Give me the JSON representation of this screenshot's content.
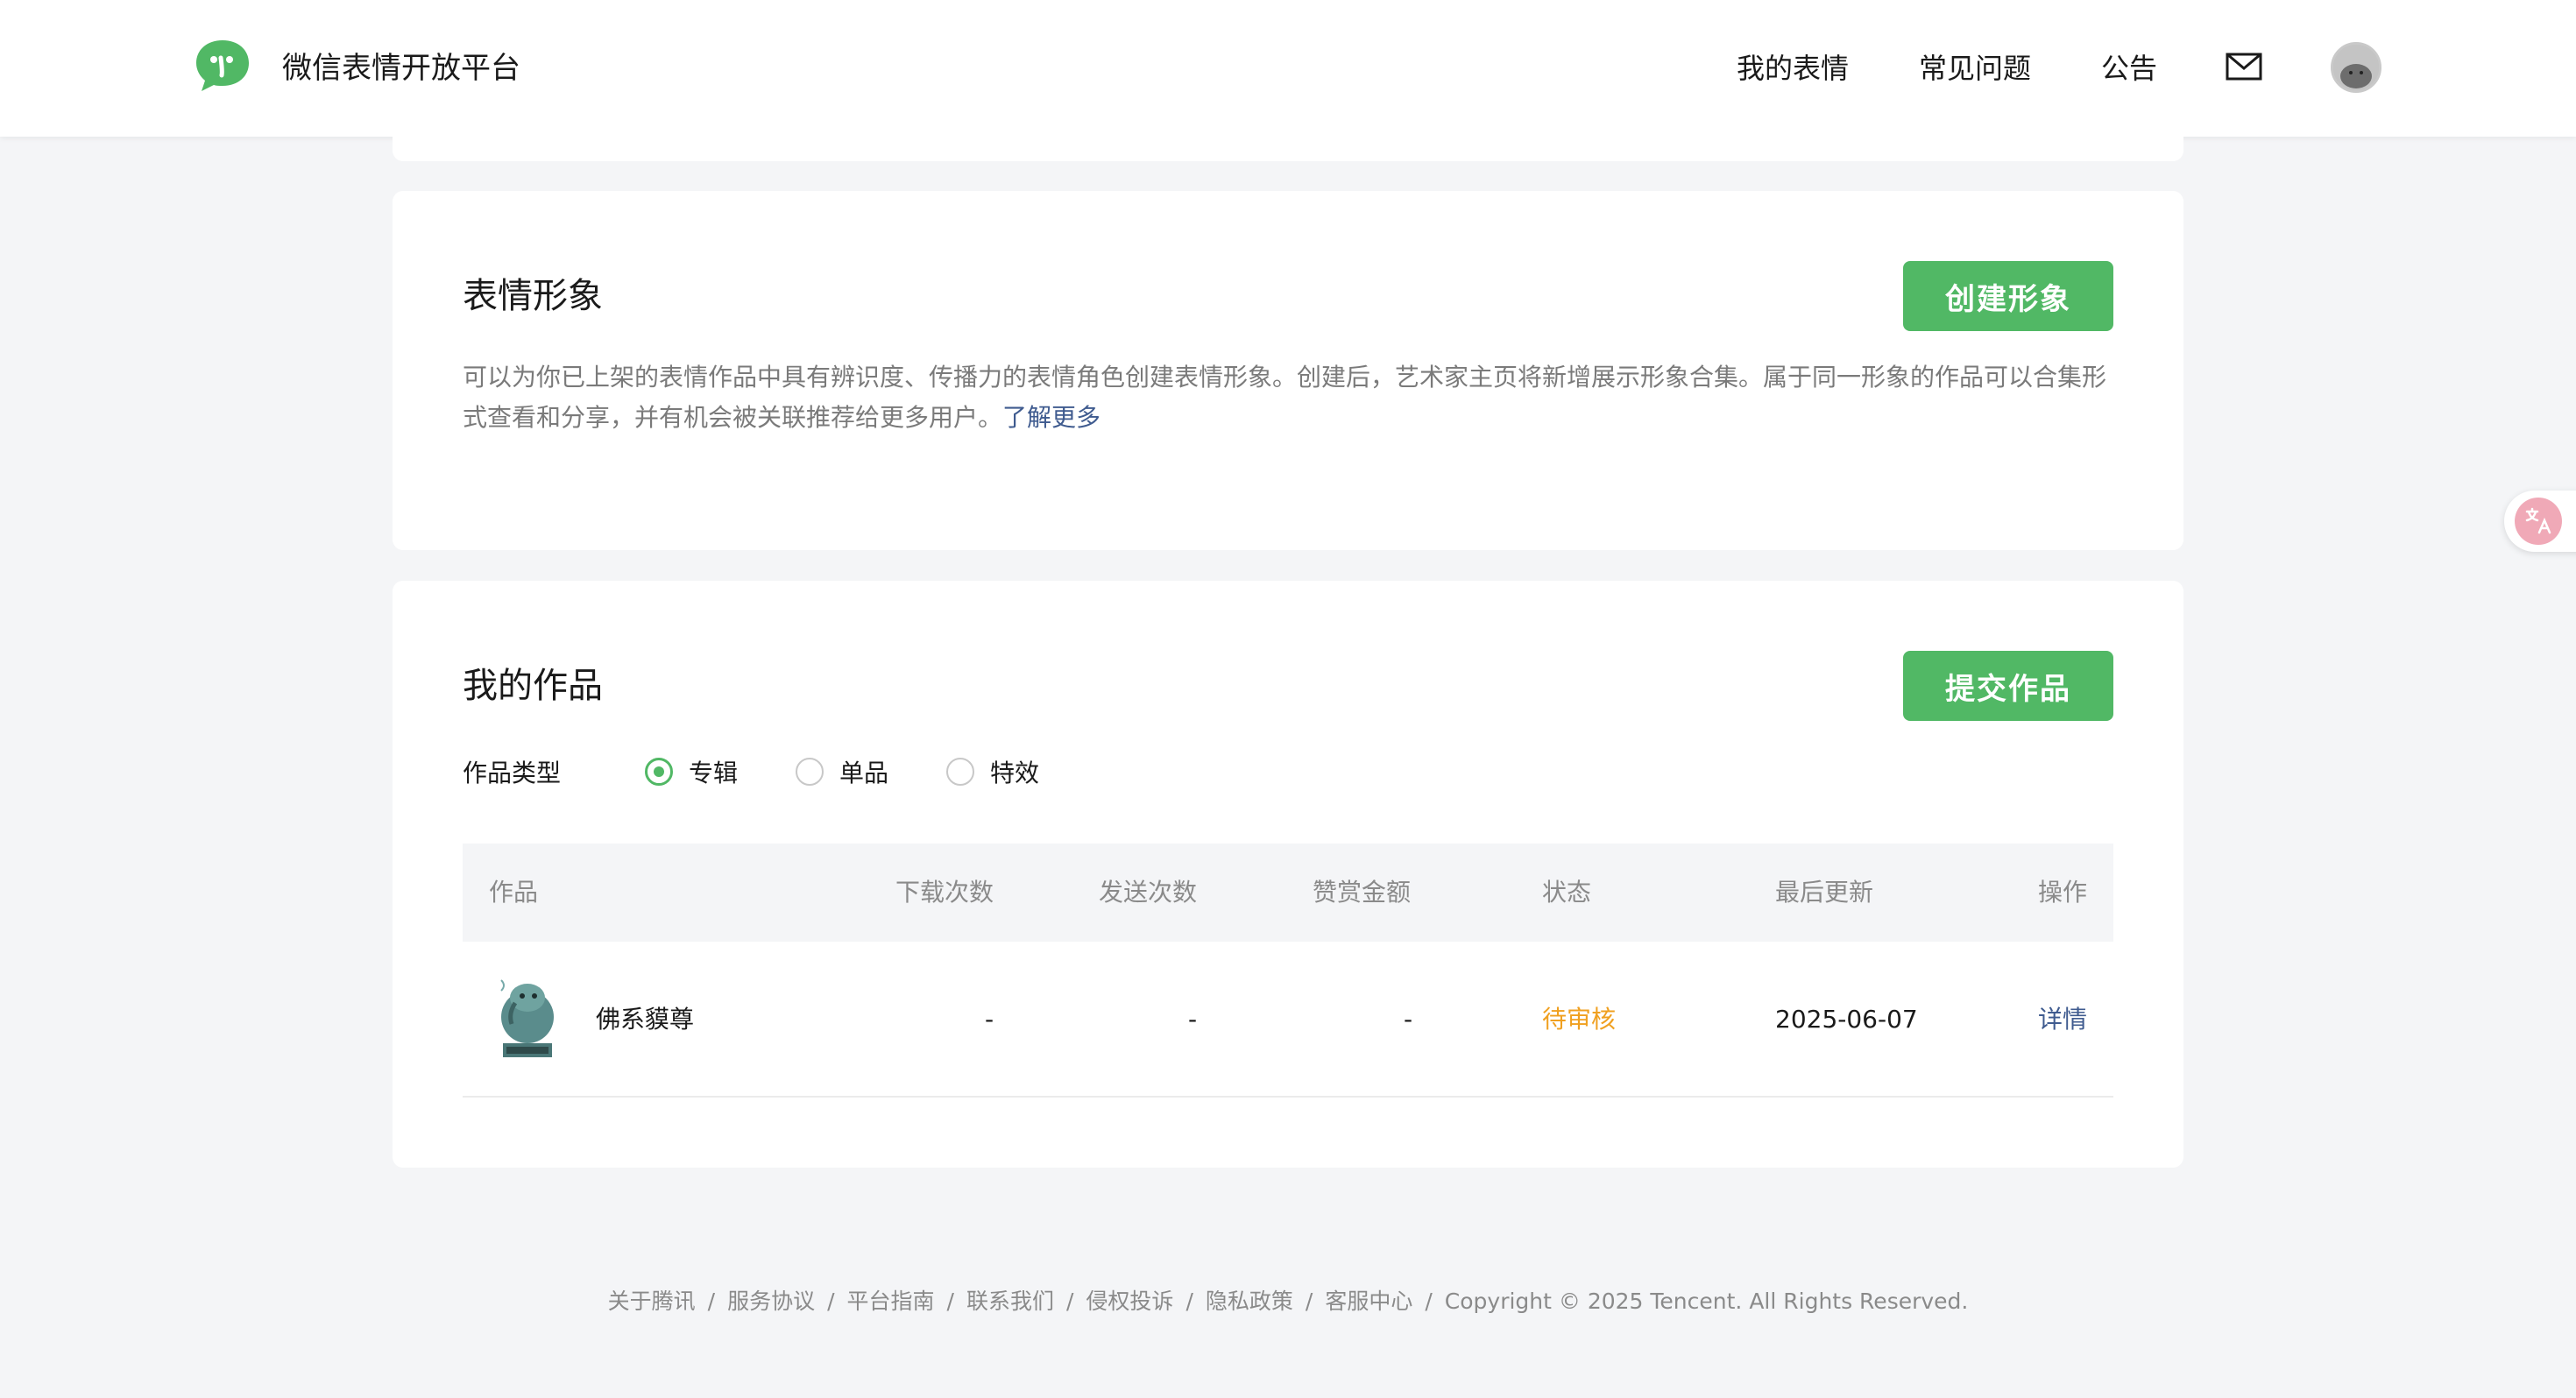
{
  "header": {
    "brand": "微信表情开放平台",
    "nav": [
      {
        "label": "我的表情",
        "active": true
      },
      {
        "label": "常见问题",
        "active": false
      },
      {
        "label": "公告",
        "active": false
      }
    ],
    "icons": {
      "logo": "wechat-emoji-logo",
      "mail": "mail-icon",
      "avatar": "user-avatar"
    }
  },
  "image_section": {
    "title": "表情形象",
    "button": "创建形象",
    "description": "可以为你已上架的表情作品中具有辨识度、传播力的表情角色创建表情形象。创建后，艺术家主页将新增展示形象合集。属于同一形象的作品可以合集形式查看和分享，并有机会被关联推荐给更多用户。",
    "learn_more": "了解更多"
  },
  "works_section": {
    "title": "我的作品",
    "button": "提交作品",
    "type_label": "作品类型",
    "types": [
      {
        "label": "专辑",
        "checked": true
      },
      {
        "label": "单品",
        "checked": false
      },
      {
        "label": "特效",
        "checked": false
      }
    ],
    "table": {
      "columns": [
        "作品",
        "下载次数",
        "发送次数",
        "赞赏金额",
        "状态",
        "最后更新",
        "操作"
      ],
      "rows": [
        {
          "name": "佛系貘尊",
          "downloads": "-",
          "sends": "-",
          "reward": "-",
          "status": "待审核",
          "updated": "2025-06-07",
          "action": "详情"
        }
      ]
    }
  },
  "footer": {
    "links": [
      "关于腾讯",
      "服务协议",
      "平台指南",
      "联系我们",
      "侵权投诉",
      "隐私政策",
      "客服中心"
    ],
    "copyright": "Copyright © 2025 Tencent. All Rights Reserved."
  },
  "colors": {
    "accent": "#51b865",
    "pending": "#f0a020",
    "link": "#3f5b8f"
  }
}
